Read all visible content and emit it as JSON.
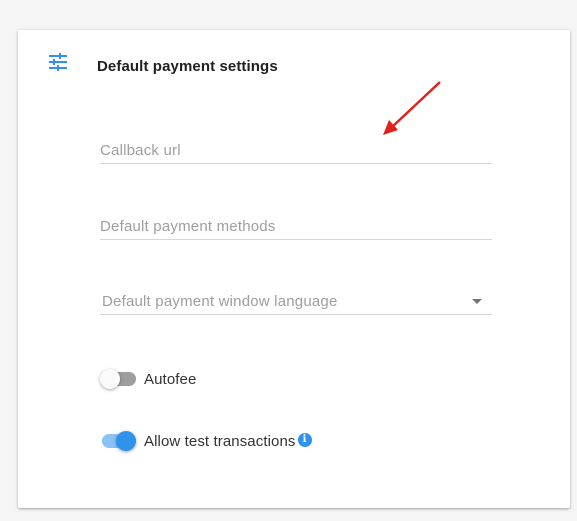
{
  "card": {
    "title": "Default payment settings",
    "icon": "sliders-settings-icon"
  },
  "fields": {
    "callback_url": {
      "placeholder": "Callback url",
      "value": ""
    },
    "payment_methods": {
      "placeholder": "Default payment methods",
      "value": ""
    },
    "window_language": {
      "placeholder": "Default payment window language",
      "selected": ""
    }
  },
  "toggles": {
    "autofee": {
      "label": "Autofee",
      "on": false
    },
    "test_transactions": {
      "label": "Allow test transactions",
      "on": true,
      "info_icon": "info-icon"
    }
  },
  "colors": {
    "accent": "#2f93eb",
    "accent_track": "#8cc2f3",
    "off_track": "#9e9e9e",
    "annotation_arrow": "#e0201b"
  },
  "info_glyph": "i"
}
